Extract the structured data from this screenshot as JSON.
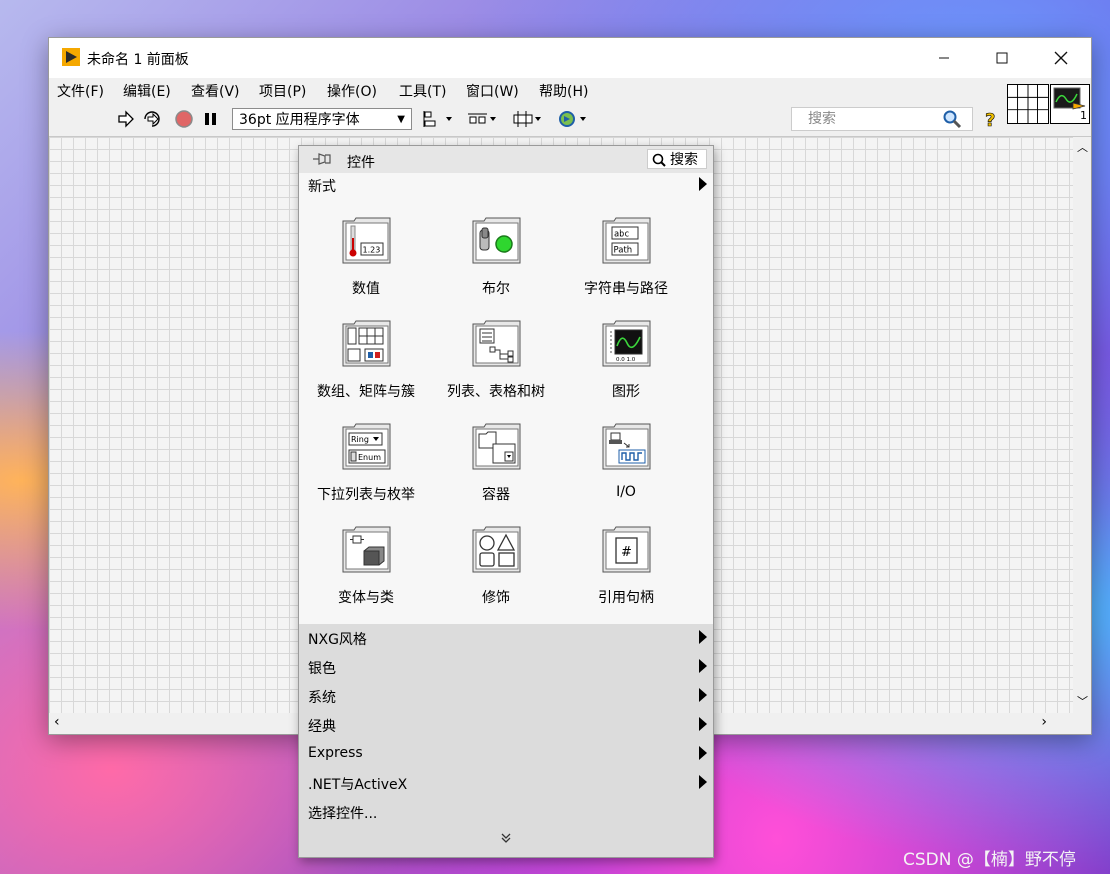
{
  "window": {
    "title": "未命名 1 前面板"
  },
  "menu": [
    "文件(F)",
    "编辑(E)",
    "查看(V)",
    "项目(P)",
    "操作(O)",
    "工具(T)",
    "窗口(W)",
    "帮助(H)"
  ],
  "toolbar": {
    "font_value": "36pt 应用程序字体",
    "search_placeholder": "搜索"
  },
  "connector": {
    "terminal_label": "1"
  },
  "palette": {
    "title": "控件",
    "search_label": "搜索",
    "top_category": "新式",
    "controls": [
      {
        "label": "数值",
        "icon": "numeric-icon"
      },
      {
        "label": "布尔",
        "icon": "boolean-icon"
      },
      {
        "label": "字符串与路径",
        "icon": "string-path-icon"
      },
      {
        "label": "数组、矩阵与簇",
        "icon": "array-matrix-cluster-icon"
      },
      {
        "label": "列表、表格和树",
        "icon": "list-table-tree-icon"
      },
      {
        "label": "图形",
        "icon": "graph-icon"
      },
      {
        "label": "下拉列表与枚举",
        "icon": "ring-enum-icon"
      },
      {
        "label": "容器",
        "icon": "container-icon"
      },
      {
        "label": "I/O",
        "icon": "io-icon"
      },
      {
        "label": "变体与类",
        "icon": "variant-class-icon"
      },
      {
        "label": "修饰",
        "icon": "decorations-icon"
      },
      {
        "label": "引用句柄",
        "icon": "refnum-icon"
      }
    ],
    "icon_text": {
      "numeric": "1.23",
      "string_top": "abc",
      "string_bottom": "Path",
      "ring": "Ring",
      "enum": "Enum",
      "graph_ticks": "0.0 1.0",
      "refnum": "#"
    },
    "categories": [
      "NXG风格",
      "银色",
      "系统",
      "经典",
      "Express",
      ".NET与ActiveX"
    ],
    "select_controls": "选择控件..."
  },
  "watermark": "CSDN @【楠】野不停",
  "colors": {
    "accent": "#00a000",
    "title_bar": "#ffffff",
    "palette_bottom": "#dcdcdc"
  }
}
